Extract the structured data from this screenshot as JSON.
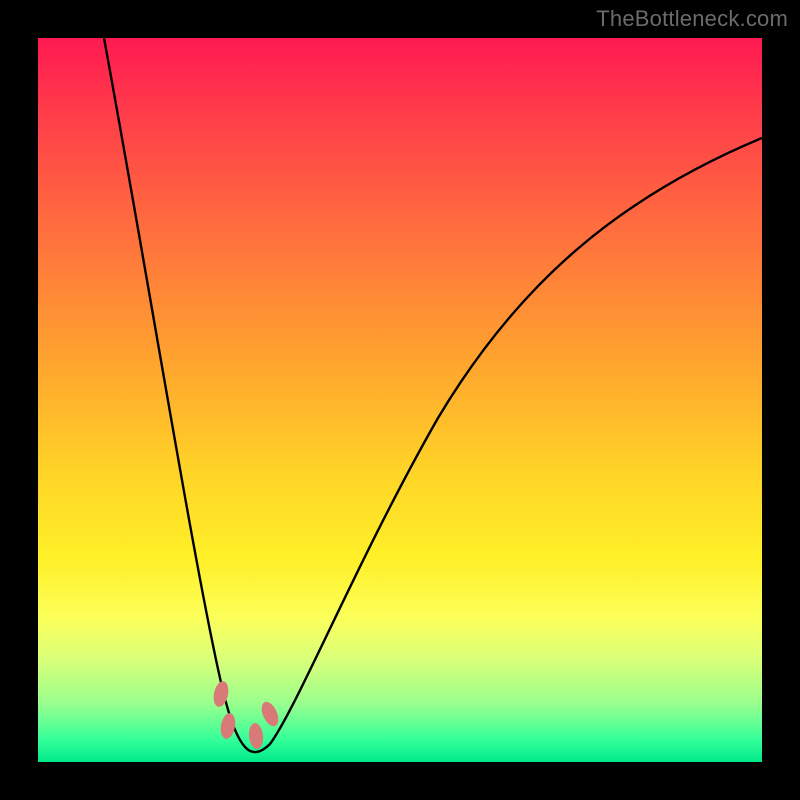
{
  "attribution": "TheBottleneck.com",
  "chart_data": {
    "type": "line",
    "title": "",
    "xlabel": "",
    "ylabel": "",
    "xlim": [
      0,
      100
    ],
    "ylim": [
      0,
      100
    ],
    "series": [
      {
        "name": "bottleneck-curve",
        "x": [
          9,
          12,
          15,
          18,
          21,
          23,
          25,
          27,
          29,
          31,
          35,
          40,
          45,
          50,
          55,
          60,
          65,
          70,
          75,
          80,
          85,
          90,
          95,
          100
        ],
        "y": [
          100,
          80,
          62,
          45,
          30,
          18,
          8,
          2,
          0,
          2,
          8,
          20,
          32,
          43,
          52,
          59,
          65,
          70,
          74,
          77,
          80,
          82,
          84,
          86
        ]
      }
    ],
    "markers": [
      {
        "name": "marker-a",
        "x": 25.3,
        "y": 7.0
      },
      {
        "name": "marker-b",
        "x": 25.7,
        "y": 2.5
      },
      {
        "name": "marker-c",
        "x": 29.8,
        "y": 1.8
      },
      {
        "name": "marker-d",
        "x": 31.5,
        "y": 4.8
      }
    ],
    "colors": {
      "curve": "#000000",
      "marker": "#d97a78",
      "gradient_top": "#ff1a52",
      "gradient_bottom": "#00e88a"
    }
  }
}
